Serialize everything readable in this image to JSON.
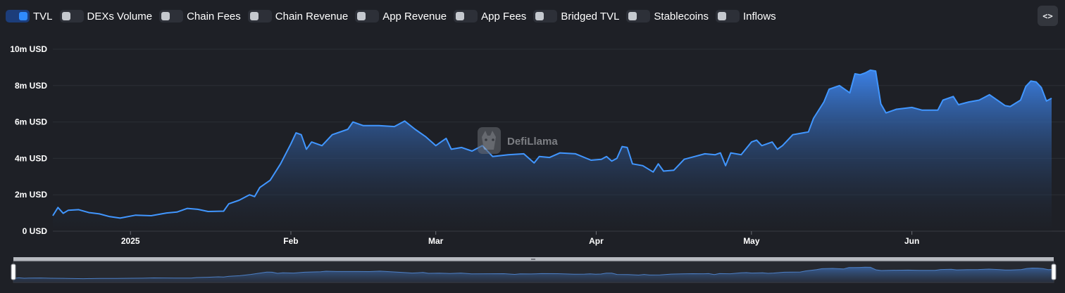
{
  "toggles": [
    {
      "label": "TVL",
      "on": true
    },
    {
      "label": "DEXs Volume",
      "on": false
    },
    {
      "label": "Chain Fees",
      "on": false
    },
    {
      "label": "Chain Revenue",
      "on": false
    },
    {
      "label": "App Revenue",
      "on": false
    },
    {
      "label": "App Fees",
      "on": false
    },
    {
      "label": "Bridged TVL",
      "on": false
    },
    {
      "label": "Stablecoins",
      "on": false
    },
    {
      "label": "Inflows",
      "on": false
    }
  ],
  "embed_icon": "code-brackets-icon",
  "embed_label": "<>",
  "watermark": "DefiLlama",
  "watermark_icon": "llama-logo-icon",
  "colors": {
    "series": "#4196ff",
    "background": "#1e2026",
    "grid": "#2b2e35",
    "toggle_on": "#2f8bff"
  },
  "chart_data": {
    "type": "area",
    "title": "",
    "xlabel": "",
    "ylabel": "",
    "x_start": "2024-12-17",
    "ylim": [
      0,
      10000000
    ],
    "y_ticks": [
      "0 USD",
      "2m USD",
      "4m USD",
      "6m USD",
      "8m USD",
      "10m USD"
    ],
    "y_tick_values": [
      0,
      2000000,
      4000000,
      6000000,
      8000000,
      10000000
    ],
    "x_ticks": [
      {
        "label": "2025",
        "date": "2025-01-01"
      },
      {
        "label": "Feb",
        "date": "2025-02-01"
      },
      {
        "label": "Mar",
        "date": "2025-03-01"
      },
      {
        "label": "Apr",
        "date": "2025-04-01"
      },
      {
        "label": "May",
        "date": "2025-05-01"
      },
      {
        "label": "Jun",
        "date": "2025-06-01"
      }
    ],
    "grid": true,
    "legend": "none",
    "series": [
      {
        "name": "TVL",
        "points": [
          [
            "2024-12-17",
            0.85
          ],
          [
            "2024-12-18",
            1.3
          ],
          [
            "2024-12-19",
            0.98
          ],
          [
            "2024-12-20",
            1.15
          ],
          [
            "2024-12-22",
            1.18
          ],
          [
            "2024-12-24",
            1.02
          ],
          [
            "2024-12-26",
            0.95
          ],
          [
            "2024-12-28",
            0.8
          ],
          [
            "2024-12-30",
            0.72
          ],
          [
            "2025-01-02",
            0.88
          ],
          [
            "2025-01-05",
            0.85
          ],
          [
            "2025-01-08",
            1.0
          ],
          [
            "2025-01-10",
            1.05
          ],
          [
            "2025-01-12",
            1.25
          ],
          [
            "2025-01-14",
            1.2
          ],
          [
            "2025-01-16",
            1.08
          ],
          [
            "2025-01-19",
            1.1
          ],
          [
            "2025-01-20",
            1.5
          ],
          [
            "2025-01-22",
            1.7
          ],
          [
            "2025-01-24",
            2.0
          ],
          [
            "2025-01-25",
            1.9
          ],
          [
            "2025-01-26",
            2.4
          ],
          [
            "2025-01-28",
            2.8
          ],
          [
            "2025-01-30",
            3.7
          ],
          [
            "2025-02-01",
            4.8
          ],
          [
            "2025-02-02",
            5.4
          ],
          [
            "2025-02-03",
            5.3
          ],
          [
            "2025-02-04",
            4.5
          ],
          [
            "2025-02-05",
            4.9
          ],
          [
            "2025-02-07",
            4.7
          ],
          [
            "2025-02-09",
            5.3
          ],
          [
            "2025-02-12",
            5.6
          ],
          [
            "2025-02-13",
            6.0
          ],
          [
            "2025-02-15",
            5.8
          ],
          [
            "2025-02-18",
            5.8
          ],
          [
            "2025-02-21",
            5.75
          ],
          [
            "2025-02-23",
            6.05
          ],
          [
            "2025-02-25",
            5.6
          ],
          [
            "2025-02-27",
            5.2
          ],
          [
            "2025-03-01",
            4.7
          ],
          [
            "2025-03-02",
            4.9
          ],
          [
            "2025-03-03",
            5.1
          ],
          [
            "2025-03-04",
            4.5
          ],
          [
            "2025-03-06",
            4.6
          ],
          [
            "2025-03-08",
            4.4
          ],
          [
            "2025-03-10",
            4.7
          ],
          [
            "2025-03-12",
            4.1
          ],
          [
            "2025-03-15",
            4.2
          ],
          [
            "2025-03-18",
            4.25
          ],
          [
            "2025-03-20",
            3.75
          ],
          [
            "2025-03-21",
            4.1
          ],
          [
            "2025-03-23",
            4.05
          ],
          [
            "2025-03-25",
            4.3
          ],
          [
            "2025-03-28",
            4.25
          ],
          [
            "2025-03-31",
            3.9
          ],
          [
            "2025-04-02",
            3.95
          ],
          [
            "2025-04-03",
            4.1
          ],
          [
            "2025-04-04",
            3.85
          ],
          [
            "2025-04-05",
            4.0
          ],
          [
            "2025-04-06",
            4.65
          ],
          [
            "2025-04-07",
            4.6
          ],
          [
            "2025-04-08",
            3.7
          ],
          [
            "2025-04-10",
            3.6
          ],
          [
            "2025-04-12",
            3.25
          ],
          [
            "2025-04-13",
            3.7
          ],
          [
            "2025-04-14",
            3.3
          ],
          [
            "2025-04-16",
            3.35
          ],
          [
            "2025-04-18",
            3.95
          ],
          [
            "2025-04-20",
            4.1
          ],
          [
            "2025-04-22",
            4.25
          ],
          [
            "2025-04-24",
            4.2
          ],
          [
            "2025-04-25",
            4.3
          ],
          [
            "2025-04-26",
            3.6
          ],
          [
            "2025-04-27",
            4.3
          ],
          [
            "2025-04-29",
            4.2
          ],
          [
            "2025-05-01",
            4.9
          ],
          [
            "2025-05-02",
            5.0
          ],
          [
            "2025-05-03",
            4.7
          ],
          [
            "2025-05-05",
            4.9
          ],
          [
            "2025-05-06",
            4.5
          ],
          [
            "2025-05-07",
            4.7
          ],
          [
            "2025-05-09",
            5.3
          ],
          [
            "2025-05-12",
            5.45
          ],
          [
            "2025-05-13",
            6.2
          ],
          [
            "2025-05-15",
            7.1
          ],
          [
            "2025-05-16",
            7.8
          ],
          [
            "2025-05-18",
            8.0
          ],
          [
            "2025-05-20",
            7.6
          ],
          [
            "2025-05-21",
            8.65
          ],
          [
            "2025-05-22",
            8.6
          ],
          [
            "2025-05-23",
            8.7
          ],
          [
            "2025-05-24",
            8.85
          ],
          [
            "2025-05-25",
            8.8
          ],
          [
            "2025-05-26",
            7.0
          ],
          [
            "2025-05-27",
            6.5
          ],
          [
            "2025-05-29",
            6.7
          ],
          [
            "2025-06-01",
            6.8
          ],
          [
            "2025-06-03",
            6.65
          ],
          [
            "2025-06-06",
            6.65
          ],
          [
            "2025-06-07",
            7.2
          ],
          [
            "2025-06-09",
            7.4
          ],
          [
            "2025-06-10",
            6.95
          ],
          [
            "2025-06-12",
            7.1
          ],
          [
            "2025-06-14",
            7.2
          ],
          [
            "2025-06-16",
            7.5
          ],
          [
            "2025-06-18",
            7.1
          ],
          [
            "2025-06-19",
            6.9
          ],
          [
            "2025-06-20",
            6.85
          ],
          [
            "2025-06-22",
            7.2
          ],
          [
            "2025-06-23",
            7.95
          ],
          [
            "2025-06-24",
            8.25
          ],
          [
            "2025-06-25",
            8.2
          ],
          [
            "2025-06-26",
            7.9
          ],
          [
            "2025-06-27",
            7.15
          ],
          [
            "2025-06-28",
            7.3
          ]
        ],
        "unit": "m USD"
      }
    ],
    "brush": {
      "start_fraction": 0.0,
      "end_fraction": 1.0
    }
  }
}
